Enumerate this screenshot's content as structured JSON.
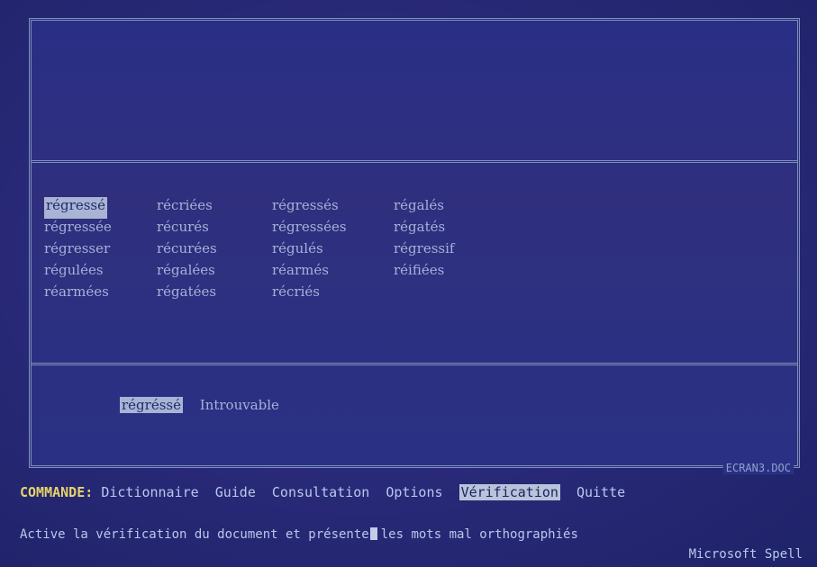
{
  "suggestions": {
    "rows": [
      [
        "régressé",
        "récriées",
        "régressés",
        "régalés"
      ],
      [
        "régressée",
        "récurés",
        "régressées",
        "régatés"
      ],
      [
        "régresser",
        "récurées",
        "régulés",
        "régressif"
      ],
      [
        "régulées",
        "régalées",
        "réarmés",
        "réifiées"
      ],
      [
        "réarmées",
        "régatées",
        "récriés",
        ""
      ]
    ]
  },
  "status": {
    "word": "régréssé",
    "message": "Introuvable"
  },
  "document": {
    "name": "ECRAN3.DOC"
  },
  "command_bar": {
    "label": "COMMANDE:",
    "items": [
      "Dictionnaire",
      "Guide",
      "Consultation",
      "Options",
      "Vérification",
      "Quitte"
    ],
    "active": "Vérification"
  },
  "message_line": {
    "before_cursor": "Active la vérification du document et présente",
    "after_cursor": "les mots mal orthographiés"
  },
  "app": {
    "name": "Microsoft Spell"
  }
}
